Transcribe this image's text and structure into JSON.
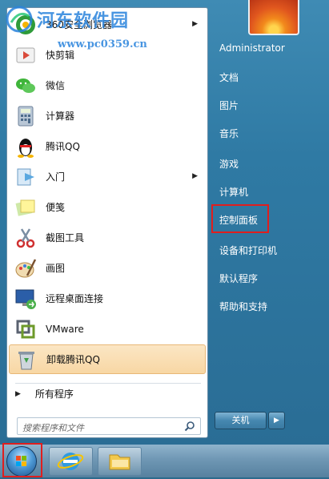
{
  "programs": [
    {
      "label": "360安全浏览器",
      "icon": "360-browser-icon",
      "has_submenu": true
    },
    {
      "label": "快剪辑",
      "icon": "video-edit-icon",
      "has_submenu": false
    },
    {
      "label": "微信",
      "icon": "wechat-icon",
      "has_submenu": false
    },
    {
      "label": "计算器",
      "icon": "calculator-icon",
      "has_submenu": false
    },
    {
      "label": "腾讯QQ",
      "icon": "qq-penguin-icon",
      "has_submenu": false
    },
    {
      "label": "入门",
      "icon": "getting-started-icon",
      "has_submenu": true
    },
    {
      "label": "便笺",
      "icon": "sticky-notes-icon",
      "has_submenu": false
    },
    {
      "label": "截图工具",
      "icon": "snipping-tool-icon",
      "has_submenu": false
    },
    {
      "label": "画图",
      "icon": "paint-icon",
      "has_submenu": false
    },
    {
      "label": "远程桌面连接",
      "icon": "remote-desktop-icon",
      "has_submenu": false
    },
    {
      "label": "VMware",
      "icon": "vmware-icon",
      "has_submenu": false
    },
    {
      "label": "卸载腾讯QQ",
      "icon": "uninstall-icon",
      "has_submenu": false,
      "highlighted": true
    }
  ],
  "all_programs": "所有程序",
  "search": {
    "placeholder": "搜索程序和文件"
  },
  "right_menu": [
    {
      "label": "Administrator"
    },
    {
      "label": "文档"
    },
    {
      "label": "图片"
    },
    {
      "label": "音乐"
    },
    {
      "label": "游戏"
    },
    {
      "label": "计算机"
    },
    {
      "label": "控制面板",
      "highlighted": true
    },
    {
      "label": "设备和打印机"
    },
    {
      "label": "默认程序"
    },
    {
      "label": "帮助和支持"
    }
  ],
  "shutdown": {
    "label": "关机",
    "arrow": "▶"
  },
  "watermark": {
    "line1": "河东软件园",
    "line2": "www.pc0359.cn"
  },
  "taskbar": {
    "items": [
      "start-orb",
      "internet-explorer-icon",
      "windows-explorer-icon"
    ]
  },
  "colors": {
    "highlight_box": "#e01e1e",
    "selected_item": "#f8d7a4"
  }
}
